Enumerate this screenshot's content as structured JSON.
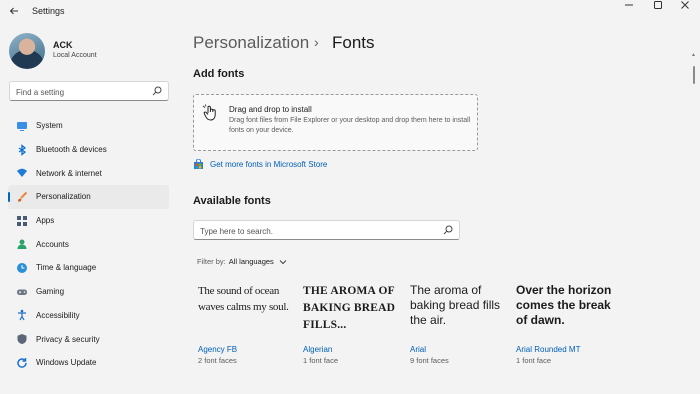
{
  "window": {
    "title": "Settings"
  },
  "user": {
    "name": "ACK",
    "account": "Local Account"
  },
  "sidebar": {
    "search_placeholder": "Find a setting",
    "items": [
      {
        "label": "System",
        "icon": "system-icon"
      },
      {
        "label": "Bluetooth & devices",
        "icon": "bluetooth-icon"
      },
      {
        "label": "Network & internet",
        "icon": "wifi-icon"
      },
      {
        "label": "Personalization",
        "icon": "brush-icon",
        "active": true
      },
      {
        "label": "Apps",
        "icon": "apps-icon"
      },
      {
        "label": "Accounts",
        "icon": "accounts-icon"
      },
      {
        "label": "Time & language",
        "icon": "globe-clock-icon"
      },
      {
        "label": "Gaming",
        "icon": "gamepad-icon"
      },
      {
        "label": "Accessibility",
        "icon": "accessibility-icon"
      },
      {
        "label": "Privacy & security",
        "icon": "shield-icon"
      },
      {
        "label": "Windows Update",
        "icon": "update-icon"
      }
    ]
  },
  "breadcrumb": {
    "parent": "Personalization",
    "separator": "›",
    "current": "Fonts"
  },
  "add_fonts": {
    "heading": "Add fonts",
    "drop_title": "Drag and drop to install",
    "drop_desc": "Drag font files from File Explorer or your desktop and drop them here to install fonts on your device.",
    "store_link": "Get more fonts in Microsoft Store"
  },
  "available_fonts": {
    "heading": "Available fonts",
    "search_placeholder": "Type here to search.",
    "filter_label": "Filter by:",
    "filter_value": "All languages",
    "fonts": [
      {
        "sample": "The sound of ocean waves calms my soul.",
        "name": "Agency FB",
        "faces": "2 font faces"
      },
      {
        "sample": "THE AROMA OF BAKING BREAD FILLS...",
        "name": "Algerian",
        "faces": "1 font face"
      },
      {
        "sample": "The aroma of baking bread fills the air.",
        "name": "Arial",
        "faces": "9 font faces"
      },
      {
        "sample": "Over the horizon comes the break of dawn.",
        "name": "Arial Rounded MT",
        "faces": "1 font face"
      }
    ]
  },
  "colors": {
    "accent": "#0067c0",
    "link": "#005fb8",
    "background": "#f3f3f3"
  }
}
